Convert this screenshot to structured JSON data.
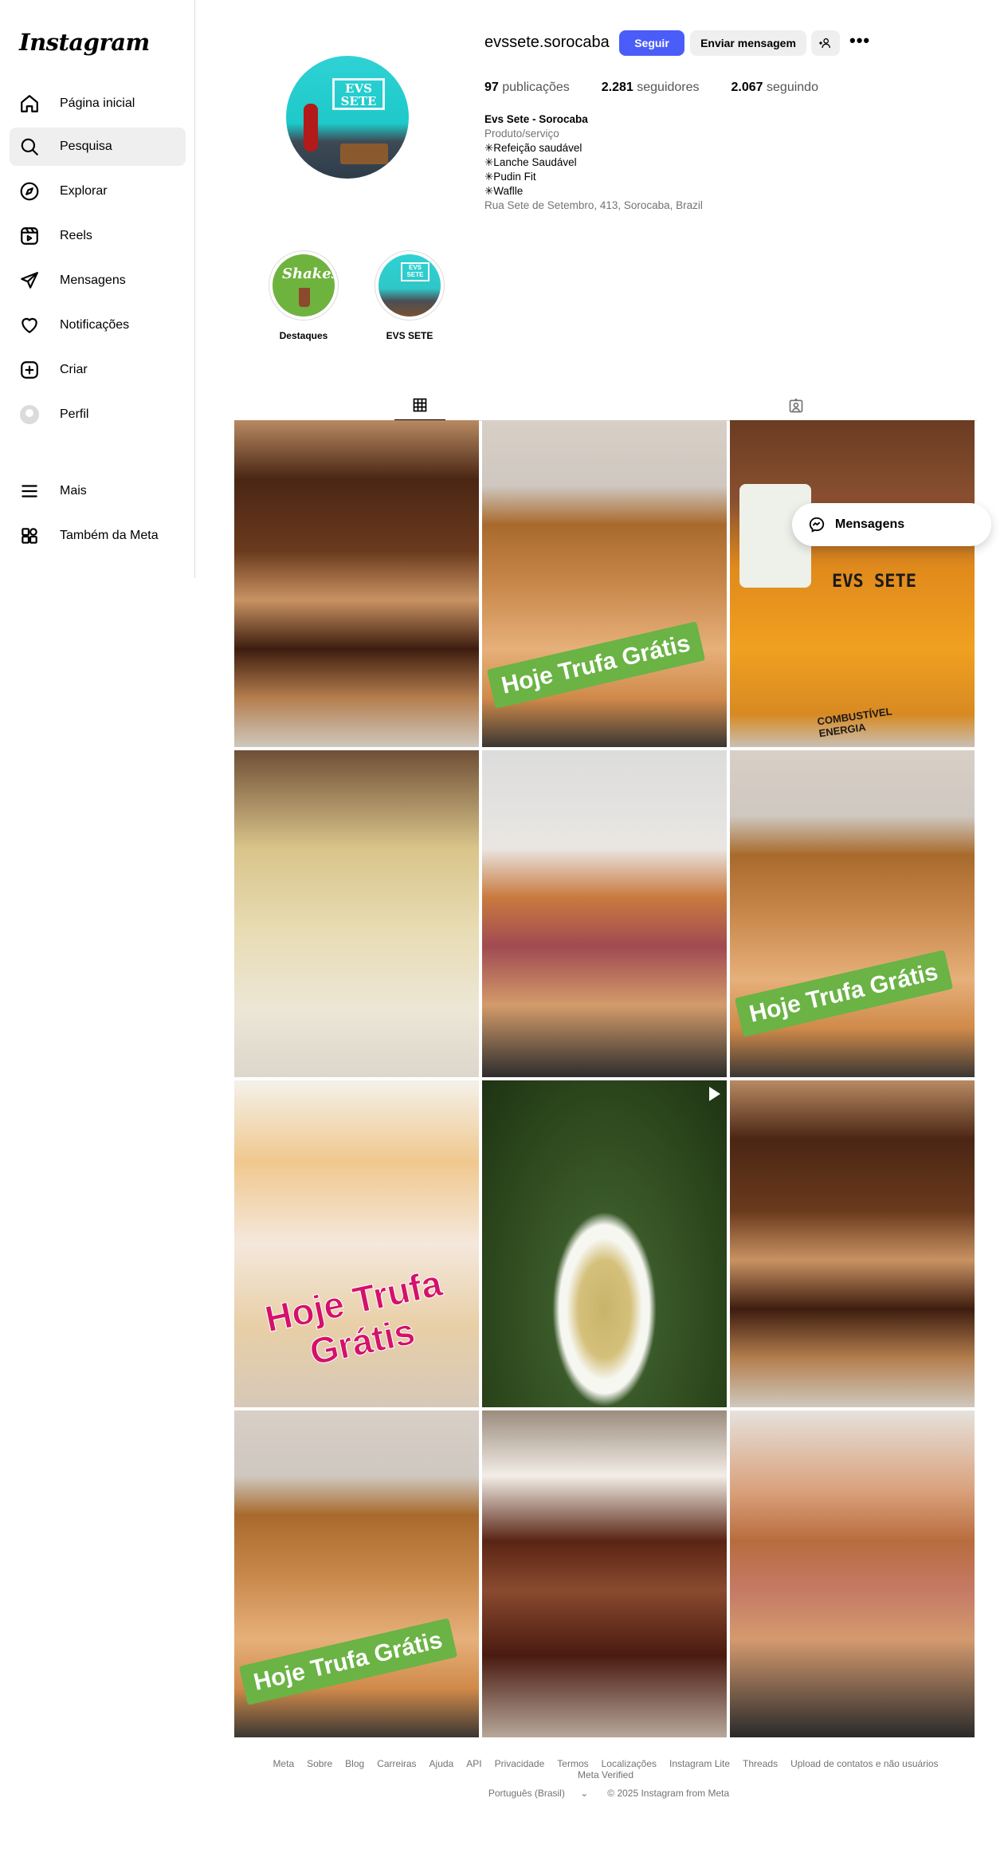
{
  "app": {
    "logo": "Instagram"
  },
  "sidebar": {
    "items": [
      {
        "label": "Página inicial",
        "icon": "home-icon"
      },
      {
        "label": "Pesquisa",
        "icon": "search-icon"
      },
      {
        "label": "Explorar",
        "icon": "compass-icon"
      },
      {
        "label": "Reels",
        "icon": "reels-icon"
      },
      {
        "label": "Mensagens",
        "icon": "send-icon"
      },
      {
        "label": "Notificações",
        "icon": "heart-icon"
      },
      {
        "label": "Criar",
        "icon": "plus-square-icon"
      },
      {
        "label": "Perfil",
        "icon": "avatar"
      },
      {
        "label": "Mais",
        "icon": "menu-icon"
      },
      {
        "label": "Também da Meta",
        "icon": "meta-apps-icon"
      }
    ],
    "active": "Pesquisa"
  },
  "profile": {
    "username": "evssete.sorocaba",
    "follow_label": "Seguir",
    "message_label": "Enviar mensagem",
    "more_label": "•••",
    "stats": {
      "posts_count": "97",
      "posts_label": "publicações",
      "followers_count": "2.281",
      "followers_label": "seguidores",
      "following_count": "2.067",
      "following_label": "seguindo"
    },
    "pic_text": "EVS\nSETE",
    "bio": {
      "name": "Evs Sete - Sorocaba",
      "category": "Produto/serviço",
      "line1": "✳Refeição saudável",
      "line2": "✳Lanche Saudável",
      "line3": "✳Pudin Fit",
      "line4": "✳Waflle",
      "address": "Rua Sete de Setembro, 413, Sorocaba, Brazil"
    }
  },
  "highlights": [
    {
      "label": "Destaques",
      "cover_text": "Shakes"
    },
    {
      "label": "EVS SETE",
      "cover_text": "EVS SETE"
    }
  ],
  "posts": {
    "banner": "Hoje Trufa Grátis",
    "pink_line1": "Hoje Trufa",
    "pink_line2": "Grátis",
    "cup_text_1": "EVS SETE",
    "cup_text_2": "COMBUSTÍVEL ENERGIA"
  },
  "messages_pill": {
    "label": "Mensagens"
  },
  "footer": {
    "links": [
      "Meta",
      "Sobre",
      "Blog",
      "Carreiras",
      "Ajuda",
      "API",
      "Privacidade",
      "Termos",
      "Localizações",
      "Instagram Lite",
      "Threads",
      "Upload de contatos e não usuários",
      "Meta Verified"
    ],
    "language": "Português (Brasil)",
    "copyright": "© 2025 Instagram from Meta"
  },
  "colors": {
    "accent": "#4a5df9",
    "banner_green": "#6ab344",
    "pink_text": "#d4116b"
  }
}
